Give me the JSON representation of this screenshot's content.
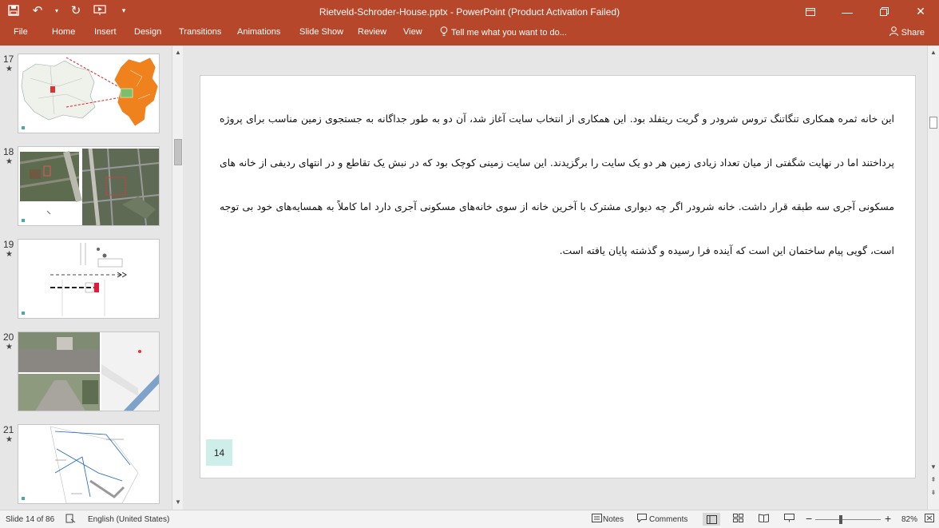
{
  "window": {
    "title": "Rietveld-Schroder-House.pptx - PowerPoint (Product Activation Failed)"
  },
  "ribbon": {
    "tabs": [
      "File",
      "Home",
      "Insert",
      "Design",
      "Transitions",
      "Animations",
      "Slide Show",
      "Review",
      "View"
    ],
    "tell_me": "Tell me what you want to do...",
    "share": "Share"
  },
  "thumbnails": [
    {
      "number": "17",
      "star": "★"
    },
    {
      "number": "18",
      "star": "★"
    },
    {
      "number": "19",
      "star": "★"
    },
    {
      "number": "20",
      "star": "★"
    },
    {
      "number": "21",
      "star": "★"
    }
  ],
  "slide": {
    "text": "این خانه ثمره همکاری تنگاتنگ تروس شرودر و گریت ریتفلد بود. این همکاری از انتخاب سایت آغاز شد، آن دو به طور جداگانه به جستجوی زمین مناسب برای پروژه پرداختند اما در نهایت شگفتی از میان تعداد زیادی زمین هر دو یک سایت را برگزیدند. این سایت زمینی کوچک بود که در نبش یک تقاطع و در انتهای ردیفی از خانه های مسکونی آجری سه طبقه قرار داشت. خانه شرودر اگر چه دیواری مشترک با آخرین خانه از سوی خانه‌های مسکونی آجری دارد اما کاملاً به همسایه‌های خود بی توجه است، گویی پیام ساختمان این است که آینده فرا رسیده و گذشته پایان یافته است.",
    "number": "14"
  },
  "status": {
    "slide_info": "Slide 14 of 86",
    "language": "English (United States)",
    "notes": "Notes",
    "comments": "Comments",
    "zoom": "82%"
  },
  "colors": {
    "accent": "#b7472a",
    "slide_number_bg": "#cdeee9"
  }
}
